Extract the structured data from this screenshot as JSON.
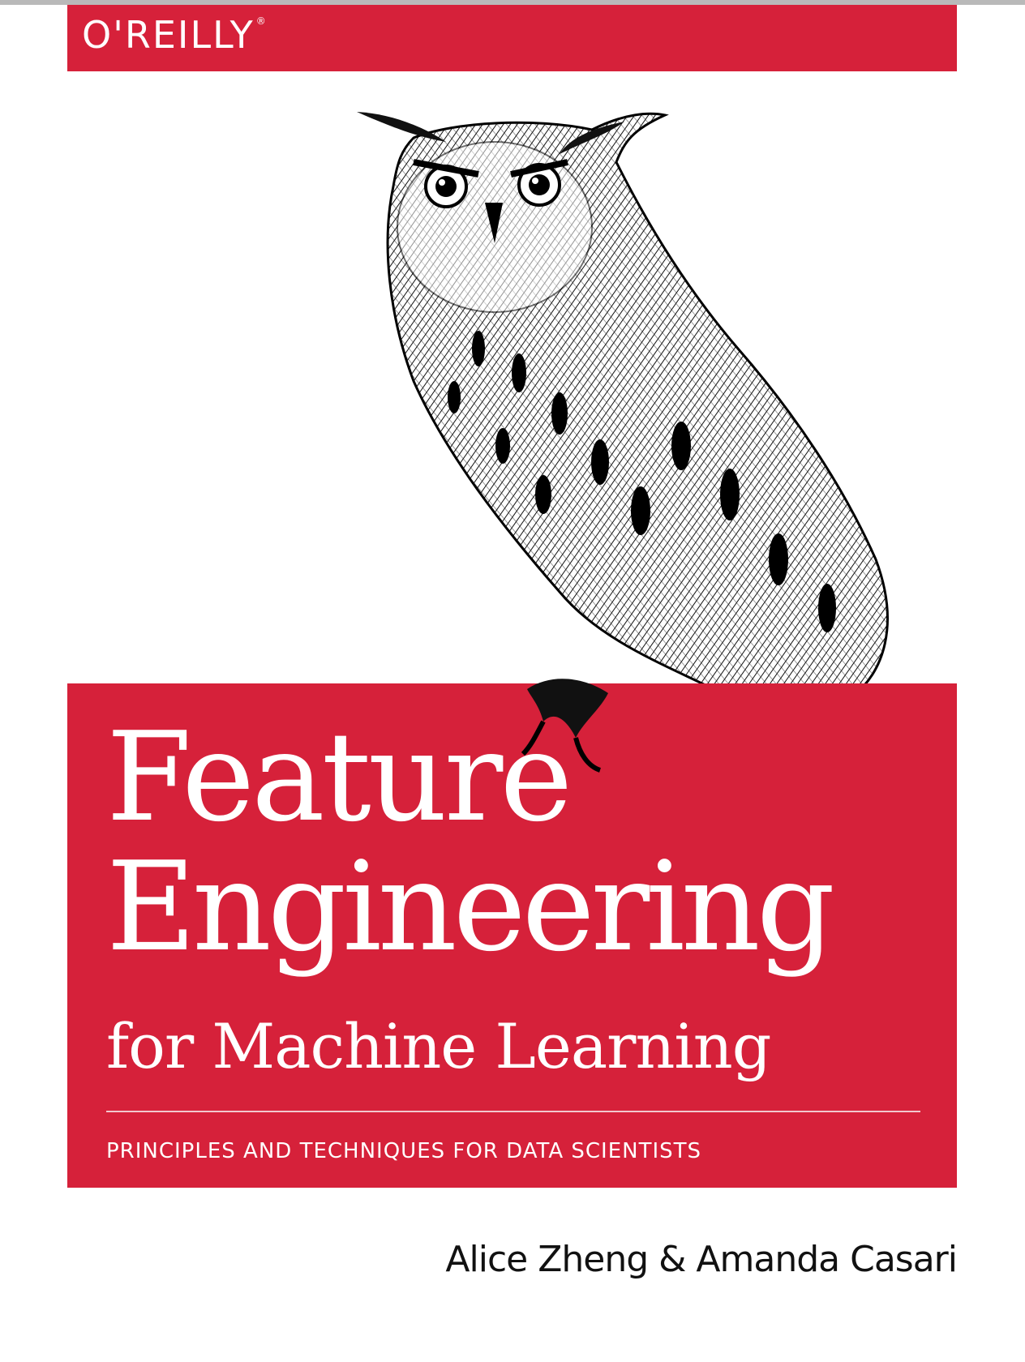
{
  "publisher": {
    "name": "O'REILLY",
    "mark": "®"
  },
  "cover": {
    "title_line1": "Feature",
    "title_line2": "Engineering",
    "title_line3": "for Machine Learning",
    "subtitle": "PRINCIPLES AND TECHNIQUES FOR DATA SCIENTISTS",
    "authors": "Alice Zheng & Amanda Casari"
  },
  "colors": {
    "brand_red": "#d6213a",
    "text_dark": "#111111",
    "white": "#ffffff"
  },
  "illustration": {
    "icon": "owl-illustration"
  }
}
